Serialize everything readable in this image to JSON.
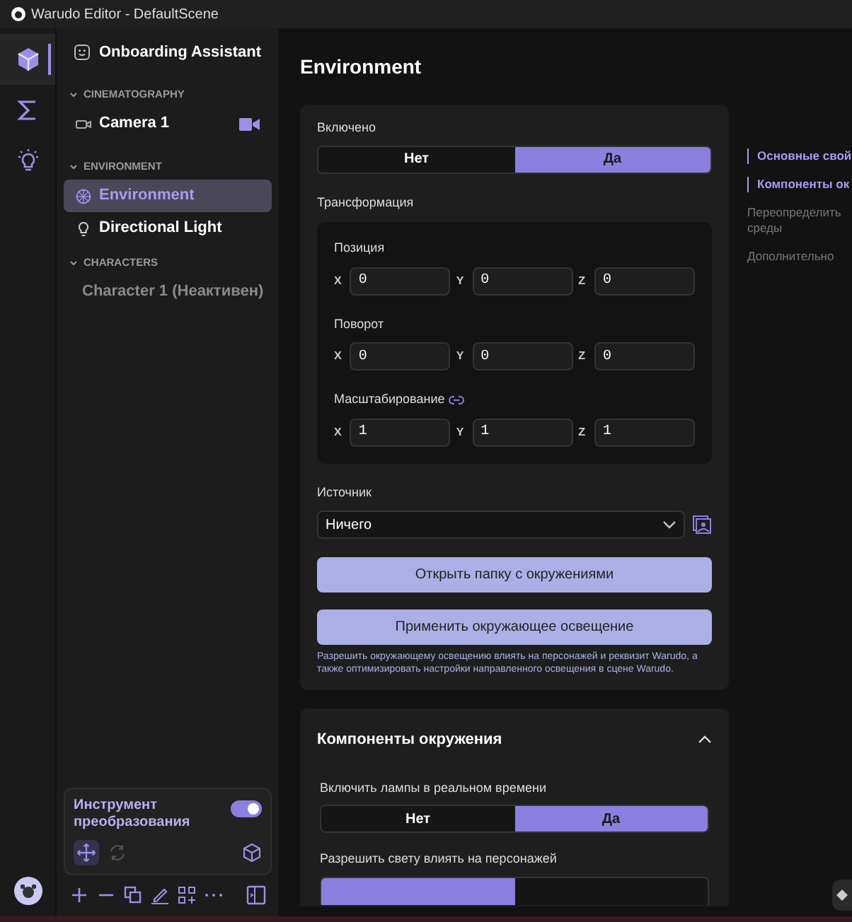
{
  "window": {
    "title": "Warudo Editor - DefaultScene"
  },
  "rail": [
    {
      "kind": "cube",
      "selected": true
    },
    {
      "kind": "sigma",
      "selected": false
    },
    {
      "kind": "bulb",
      "selected": false
    }
  ],
  "sidebar": {
    "top_item": {
      "label": "Onboarding Assistant"
    },
    "sections": [
      {
        "title": "CINEMATOGRAPHY",
        "expanded": true,
        "items": [
          {
            "label": "Camera 1",
            "kind": "camera",
            "selected": false,
            "active_camera": true
          }
        ]
      },
      {
        "title": "ENVIRONMENT",
        "expanded": true,
        "items": [
          {
            "label": "Environment",
            "kind": "environment",
            "selected": true
          },
          {
            "label": "Directional Light",
            "kind": "light",
            "selected": false
          }
        ]
      },
      {
        "title": "CHARACTERS",
        "expanded": true,
        "items": [
          {
            "label": "Character 1 (Неактивен)",
            "kind": "character",
            "selected": false,
            "inactive": true
          }
        ]
      }
    ],
    "tool_panel": {
      "title": "Инструмент преобразования",
      "on": true,
      "tools": [
        {
          "kind": "move",
          "selected": true,
          "disabled": false
        },
        {
          "kind": "rotate",
          "selected": false,
          "disabled": true
        }
      ]
    },
    "toolbar": [
      {
        "kind": "plus"
      },
      {
        "kind": "minus"
      },
      {
        "kind": "copy"
      },
      {
        "kind": "pencil"
      },
      {
        "kind": "grid-plus"
      },
      {
        "kind": "more"
      }
    ]
  },
  "main": {
    "heading": "Environment",
    "card": {
      "enabled": {
        "label": "Включено",
        "options": [
          {
            "label": "Нет",
            "selected": false
          },
          {
            "label": "Да",
            "selected": true
          }
        ]
      },
      "transform": {
        "label": "Трансформация",
        "groups": [
          {
            "label": "Позиция",
            "fields": [
              {
                "axis": "X",
                "value": "0"
              },
              {
                "axis": "Y",
                "value": "0"
              },
              {
                "axis": "Z",
                "value": "0"
              }
            ]
          },
          {
            "label": "Поворот",
            "fields": [
              {
                "axis": "X",
                "value": "0"
              },
              {
                "axis": "Y",
                "value": "0"
              },
              {
                "axis": "Z",
                "value": "0"
              }
            ]
          },
          {
            "label": "Масштабирование",
            "linked": true,
            "fields": [
              {
                "axis": "X",
                "value": "1"
              },
              {
                "axis": "Y",
                "value": "1"
              },
              {
                "axis": "Z",
                "value": "1"
              }
            ]
          }
        ]
      },
      "source": {
        "label": "Источник",
        "value": "Ничего"
      },
      "buttons": [
        "Открыть папку с окружениями",
        "Применить окружающее освещение"
      ],
      "note": "Разрешить окружающему освещению влиять на персонажей и реквизит Warudo, а также оптимизировать настройки направленного освещения в сцене Warudo."
    },
    "components": {
      "title": "Компоненты окружения",
      "expanded": true,
      "toggles": [
        {
          "label": "Включить лампы в реальном времени",
          "options": [
            {
              "label": "Нет",
              "selected": false
            },
            {
              "label": "Да",
              "selected": true
            }
          ]
        },
        {
          "label": "Разрешить свету влиять на персонажей",
          "options": [
            {
              "selected": true
            },
            {
              "selected": false
            }
          ]
        }
      ]
    }
  },
  "nav": [
    {
      "label": "Основные свой",
      "active": true
    },
    {
      "label": "Компоненты ок",
      "active": true
    },
    {
      "label": "Переопределить среды",
      "active": false
    },
    {
      "label": "Дополнительно",
      "active": false
    }
  ]
}
